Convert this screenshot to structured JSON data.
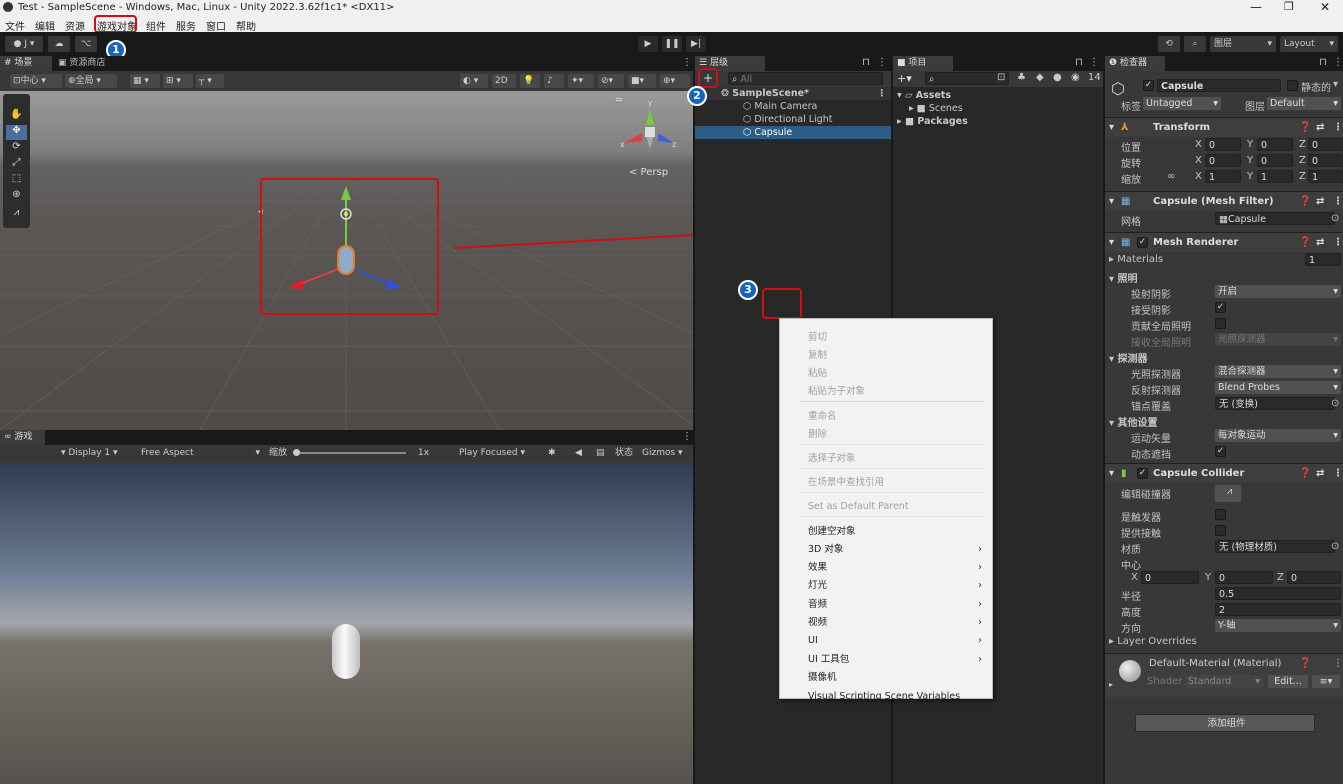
{
  "window": {
    "title": "Test - SampleScene - Windows, Mac, Linux - Unity 2022.3.62f1c1* <DX11>"
  },
  "menu": [
    "文件",
    "编辑",
    "资源",
    "游戏对象",
    "组件",
    "服务",
    "窗口",
    "帮助"
  ],
  "toolbar": {
    "account": "J ▾",
    "layers": "图层",
    "layout": "Layout"
  },
  "scene_tabs": {
    "scene": "场景",
    "store": "资源商店"
  },
  "scene_toolbar": {
    "pivot": "中心",
    "global": "全局",
    "mode_2d": "2D",
    "persp": "< Persp"
  },
  "game": {
    "tab": "游戏",
    "display": "Display 1",
    "aspect": "Free Aspect",
    "scale_label": "缩放",
    "scale_value": "1x",
    "play_mode": "Play Focused",
    "stats": "状态",
    "gizmos": "Gizmos"
  },
  "hierarchy": {
    "tab": "层级",
    "search_placeholder": "All",
    "scene": "SampleScene*",
    "items": [
      "Main Camera",
      "Directional Light",
      "Capsule"
    ]
  },
  "project": {
    "tab": "项目",
    "count": "14",
    "assets": "Assets",
    "scenes": "Scenes",
    "packages": "Packages"
  },
  "context_menu": {
    "items": [
      {
        "label": "剪切",
        "disabled": true
      },
      {
        "label": "复制",
        "disabled": true
      },
      {
        "label": "粘贴",
        "disabled": true
      },
      {
        "label": "粘贴为子对象",
        "disabled": true
      },
      {
        "label": "重命名",
        "disabled": true
      },
      {
        "label": "删除",
        "disabled": true
      },
      {
        "label": "选择子对象",
        "disabled": true
      },
      {
        "label": "在场景中查找引用",
        "disabled": true
      },
      {
        "label": "Set as Default Parent",
        "disabled": true
      },
      {
        "label": "创建空对象",
        "disabled": false
      },
      {
        "label": "3D 对象",
        "disabled": false,
        "sub": true
      },
      {
        "label": "效果",
        "disabled": false,
        "sub": true
      },
      {
        "label": "灯光",
        "disabled": false,
        "sub": true
      },
      {
        "label": "音频",
        "disabled": false,
        "sub": true
      },
      {
        "label": "视频",
        "disabled": false,
        "sub": true
      },
      {
        "label": "UI",
        "disabled": false,
        "sub": true
      },
      {
        "label": "UI 工具包",
        "disabled": false,
        "sub": true
      },
      {
        "label": "摄像机",
        "disabled": false
      },
      {
        "label": "Visual Scripting Scene Variables",
        "disabled": false
      }
    ]
  },
  "inspector": {
    "tab": "检查器",
    "object_name": "Capsule",
    "static_label": "静态的",
    "tag_label": "标签",
    "tag_value": "Untagged",
    "layer_label": "图层",
    "layer_value": "Default",
    "transform": {
      "title": "Transform",
      "position_label": "位置",
      "rotation_label": "旋转",
      "scale_label": "缩放",
      "position": {
        "x": "0",
        "y": "0",
        "z": "0"
      },
      "rotation": {
        "x": "0",
        "y": "0",
        "z": "0"
      },
      "scale": {
        "x": "1",
        "y": "1",
        "z": "1"
      }
    },
    "mesh_filter": {
      "title": "Capsule (Mesh Filter)",
      "mesh_label": "网格",
      "mesh_value": "Capsule"
    },
    "mesh_renderer": {
      "title": "Mesh Renderer",
      "materials_label": "Materials",
      "materials_count": "1",
      "lighting_label": "照明",
      "cast_shadows_label": "投射阴影",
      "cast_shadows_value": "开启",
      "receive_shadows_label": "接受阴影",
      "contribute_gi_label": "贡献全局照明",
      "receive_gi_label": "接收全局照明",
      "receive_gi_value": "光照探测器",
      "probes_label": "探测器",
      "light_probes_label": "光照探测器",
      "light_probes_value": "混合探测器",
      "reflection_probes_label": "反射探测器",
      "reflection_probes_value": "Blend Probes",
      "anchor_override_label": "锚点覆盖",
      "anchor_override_value": "无 (变换)",
      "additional_label": "其他设置",
      "motion_vectors_label": "运动矢量",
      "motion_vectors_value": "每对象运动",
      "dynamic_occlusion_label": "动态遮挡"
    },
    "capsule_collider": {
      "title": "Capsule Collider",
      "edit_label": "编辑碰撞器",
      "is_trigger_label": "是触发器",
      "provides_contacts_label": "提供接触",
      "material_label": "材质",
      "material_value": "无 (物理材质)",
      "center_label": "中心",
      "center": {
        "x": "0",
        "y": "0",
        "z": "0"
      },
      "radius_label": "半径",
      "radius_value": "0.5",
      "height_label": "高度",
      "height_value": "2",
      "direction_label": "方向",
      "direction_value": "Y-轴",
      "layer_overrides_label": "Layer Overrides"
    },
    "material": {
      "name": "Default-Material (Material)",
      "shader_label": "Shader",
      "shader_value": "Standard",
      "edit_label": "Edit..."
    },
    "add_component": "添加组件"
  },
  "annotations": {
    "badge1": "1",
    "badge2": "2",
    "badge3": "3"
  },
  "colors": {
    "accent": "#1565c0",
    "highlight_red": "#d01010",
    "selection": "#2c5d87"
  }
}
